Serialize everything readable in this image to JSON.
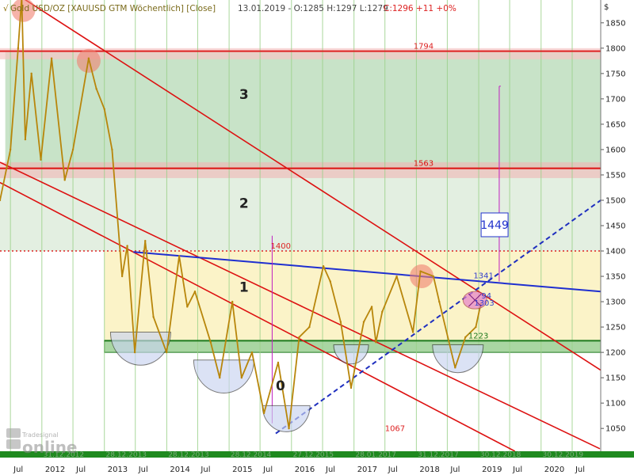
{
  "header": {
    "title": "Gold USD/OZ [XAUUSD GTM  Wöchentlich] [Close]",
    "quote": "13.01.2019 - O:1285 H:1297 L:1279",
    "change": "C:1296 +11 +0%"
  },
  "watermark": {
    "brand": "Tradesignal",
    "name": "online"
  },
  "chart_data": {
    "type": "line",
    "currency_label": "$",
    "ylim": [
      1005,
      1895
    ],
    "y_ticks": [
      1050,
      1100,
      1150,
      1200,
      1250,
      1300,
      1350,
      1400,
      1450,
      1500,
      1550,
      1600,
      1650,
      1700,
      1750,
      1800,
      1850
    ],
    "xlim": [
      "2011-05-01",
      "2020-12-15"
    ],
    "x_axis_labels": [
      {
        "date": "2011-07-01",
        "text": "Jul"
      },
      {
        "date": "2012-01-01",
        "text": "2012"
      },
      {
        "date": "2012-07-01",
        "text": "Jul"
      },
      {
        "date": "2013-01-01",
        "text": "2013"
      },
      {
        "date": "2013-07-01",
        "text": "Jul"
      },
      {
        "date": "2014-01-01",
        "text": "2014"
      },
      {
        "date": "2014-07-01",
        "text": "Jul"
      },
      {
        "date": "2015-01-01",
        "text": "2015"
      },
      {
        "date": "2015-07-01",
        "text": "Jul"
      },
      {
        "date": "2016-01-01",
        "text": "2016"
      },
      {
        "date": "2016-07-01",
        "text": "Jul"
      },
      {
        "date": "2017-01-01",
        "text": "2017"
      },
      {
        "date": "2017-07-01",
        "text": "Jul"
      },
      {
        "date": "2018-01-01",
        "text": "2018"
      },
      {
        "date": "2018-07-01",
        "text": "Jul"
      },
      {
        "date": "2019-01-01",
        "text": "2019"
      },
      {
        "date": "2019-07-01",
        "text": "Jul"
      },
      {
        "date": "2020-01-01",
        "text": "2020"
      },
      {
        "date": "2020-07-01",
        "text": "Jul"
      }
    ],
    "x_faint_labels": [
      {
        "date": "2011-12-31",
        "text": "31.12.2012"
      },
      {
        "date": "2012-12-31",
        "text": "28.12.2013"
      },
      {
        "date": "2013-12-31",
        "text": "28.12.2013"
      },
      {
        "date": "2014-12-31",
        "text": "28.12.2014"
      },
      {
        "date": "2015-12-31",
        "text": "27.12.2015"
      },
      {
        "date": "2016-12-31",
        "text": "28.01.2017"
      },
      {
        "date": "2017-12-31",
        "text": "31.12.2017"
      },
      {
        "date": "2018-12-31",
        "text": "30.12.2018"
      },
      {
        "date": "2019-12-31",
        "text": "30.12.2019"
      }
    ],
    "series": [
      {
        "name": "Gold USD/OZ",
        "color": "#b8860b",
        "x": [
          "2011-05-01",
          "2011-07-01",
          "2011-08-15",
          "2011-09-05",
          "2011-09-26",
          "2011-11-01",
          "2011-12-26",
          "2012-02-27",
          "2012-05-14",
          "2012-07-01",
          "2012-10-01",
          "2012-11-15",
          "2013-01-01",
          "2013-02-15",
          "2013-04-15",
          "2013-05-15",
          "2013-06-28",
          "2013-08-28",
          "2013-10-15",
          "2013-12-31",
          "2014-03-15",
          "2014-05-01",
          "2014-06-15",
          "2014-09-15",
          "2014-11-07",
          "2015-01-20",
          "2015-03-15",
          "2015-05-15",
          "2015-07-24",
          "2015-10-15",
          "2015-12-17",
          "2016-02-15",
          "2016-04-15",
          "2016-07-06",
          "2016-08-15",
          "2016-10-15",
          "2016-12-15",
          "2017-02-27",
          "2017-04-15",
          "2017-05-09",
          "2017-06-15",
          "2017-09-08",
          "2017-12-12",
          "2018-01-25",
          "2018-04-11",
          "2018-05-15",
          "2018-08-16",
          "2018-10-15",
          "2018-12-15",
          "2019-01-13"
        ],
        "values": [
          1500,
          1600,
          1800,
          1900,
          1620,
          1750,
          1580,
          1780,
          1540,
          1600,
          1780,
          1720,
          1680,
          1600,
          1350,
          1410,
          1200,
          1420,
          1270,
          1200,
          1390,
          1290,
          1320,
          1220,
          1150,
          1300,
          1150,
          1200,
          1080,
          1180,
          1050,
          1230,
          1250,
          1370,
          1340,
          1260,
          1130,
          1260,
          1290,
          1220,
          1280,
          1350,
          1240,
          1360,
          1350,
          1300,
          1170,
          1230,
          1250,
          1296
        ]
      }
    ],
    "zones": [
      {
        "label": "3",
        "from": 1563,
        "to": 1794,
        "color": "#c8e3c8"
      },
      {
        "label": "2",
        "from": 1400,
        "to": 1563,
        "color": "#e3efe1"
      },
      {
        "label": "1",
        "from": 1223,
        "to": 1400,
        "color": "#fbf3c8"
      },
      {
        "label": "0",
        "from": 1200,
        "to": 1223,
        "color": "#a9d6a2"
      }
    ],
    "horizontal_levels": [
      {
        "value": 1794,
        "label": "1794",
        "color": "#dd2222",
        "style": "solid"
      },
      {
        "value": 1563,
        "label": "1563",
        "color": "#dd1111",
        "style": "solid"
      },
      {
        "value": 1400,
        "label": "1400",
        "color": "#dd2222",
        "style": "dotted"
      },
      {
        "value": 1223,
        "label": "1223",
        "color": "#1e7a1e",
        "style": "solid"
      },
      {
        "value": 1067,
        "label": "1067",
        "color": "#dd2222",
        "style": "none"
      }
    ],
    "trend_lines": [
      {
        "name": "upper-channel",
        "color": "#dd1111",
        "style": "solid",
        "points": [
          [
            "2011-09-05",
            1900
          ],
          [
            "2020-12-15",
            1165
          ]
        ]
      },
      {
        "name": "middle-channel",
        "color": "#dd1111",
        "style": "solid",
        "points": [
          [
            "2011-05-01",
            1575
          ],
          [
            "2020-12-10",
            1010
          ]
        ]
      },
      {
        "name": "lower-channel",
        "color": "#dd1111",
        "style": "solid",
        "points": [
          [
            "2011-05-01",
            1535
          ],
          [
            "2019-08-01",
            1005
          ]
        ]
      },
      {
        "name": "resistance-blue",
        "color": "#1f2fd0",
        "style": "solid",
        "points": [
          [
            "2013-06-20",
            1398
          ],
          [
            "2020-12-15",
            1320
          ]
        ]
      },
      {
        "name": "support-dashed",
        "color": "#1f2fbf",
        "style": "dashed",
        "points": [
          [
            "2015-10-01",
            1040
          ],
          [
            "2020-12-15",
            1500
          ]
        ]
      }
    ],
    "annotations": {
      "target": "1449",
      "current_price": "1303",
      "current_value_partial": "94",
      "level_1341": "1341",
      "zone_numbers": [
        "0",
        "1",
        "2",
        "3"
      ]
    }
  }
}
